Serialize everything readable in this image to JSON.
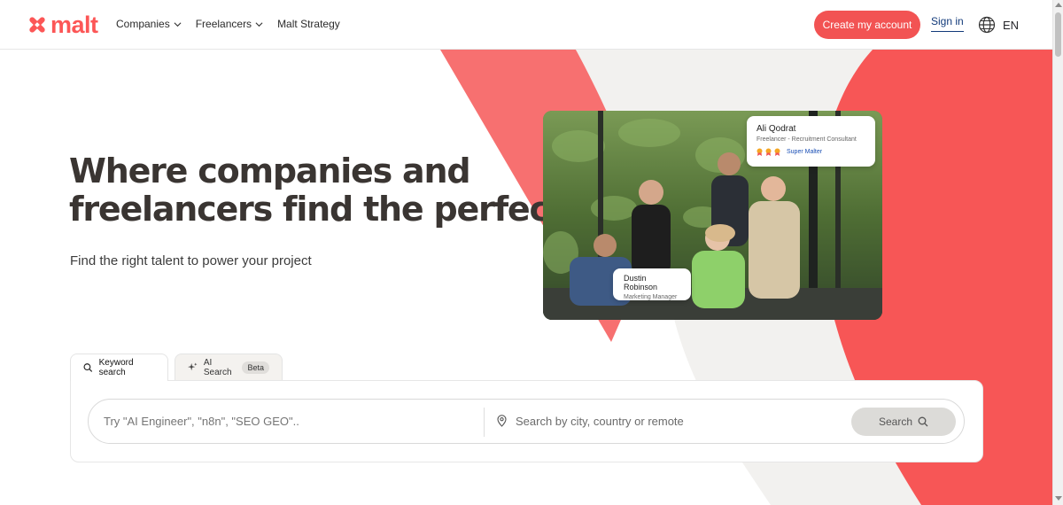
{
  "header": {
    "logo_text": "malt",
    "nav": [
      {
        "label": "Companies",
        "has_dropdown": true
      },
      {
        "label": "Freelancers",
        "has_dropdown": true
      },
      {
        "label": "Malt Strategy",
        "has_dropdown": false
      }
    ],
    "cta_label": "Create my account",
    "signin_label": "Sign in",
    "language": "EN"
  },
  "hero": {
    "headline_line1": "Where companies and",
    "headline_line2": "freelancers find the perfect fit",
    "subheadline": "Find the right talent to power your project"
  },
  "cards": {
    "ali": {
      "name": "Ali Qodrat",
      "role": "Freelancer - Recruitment Consultant",
      "badge": "Super Malter",
      "medals": 3
    },
    "dustin": {
      "name": "Dustin Robinson",
      "role": "Marketing Manager"
    }
  },
  "search": {
    "tabs": [
      {
        "label": "Keyword search",
        "icon": "search-icon",
        "active": true
      },
      {
        "label": "AI Search",
        "icon": "sparkle-icon",
        "badge": "Beta",
        "active": false
      }
    ],
    "keyword_placeholder": "Try \"AI Engineer\", \"n8n\", \"SEO GEO\"..",
    "location_placeholder": "Search by city, country or remote",
    "button_label": "Search"
  },
  "colors": {
    "brand": "#fc5656",
    "cta": "#f25353",
    "link": "#123a7a",
    "coral_light": "#f76c6c"
  }
}
